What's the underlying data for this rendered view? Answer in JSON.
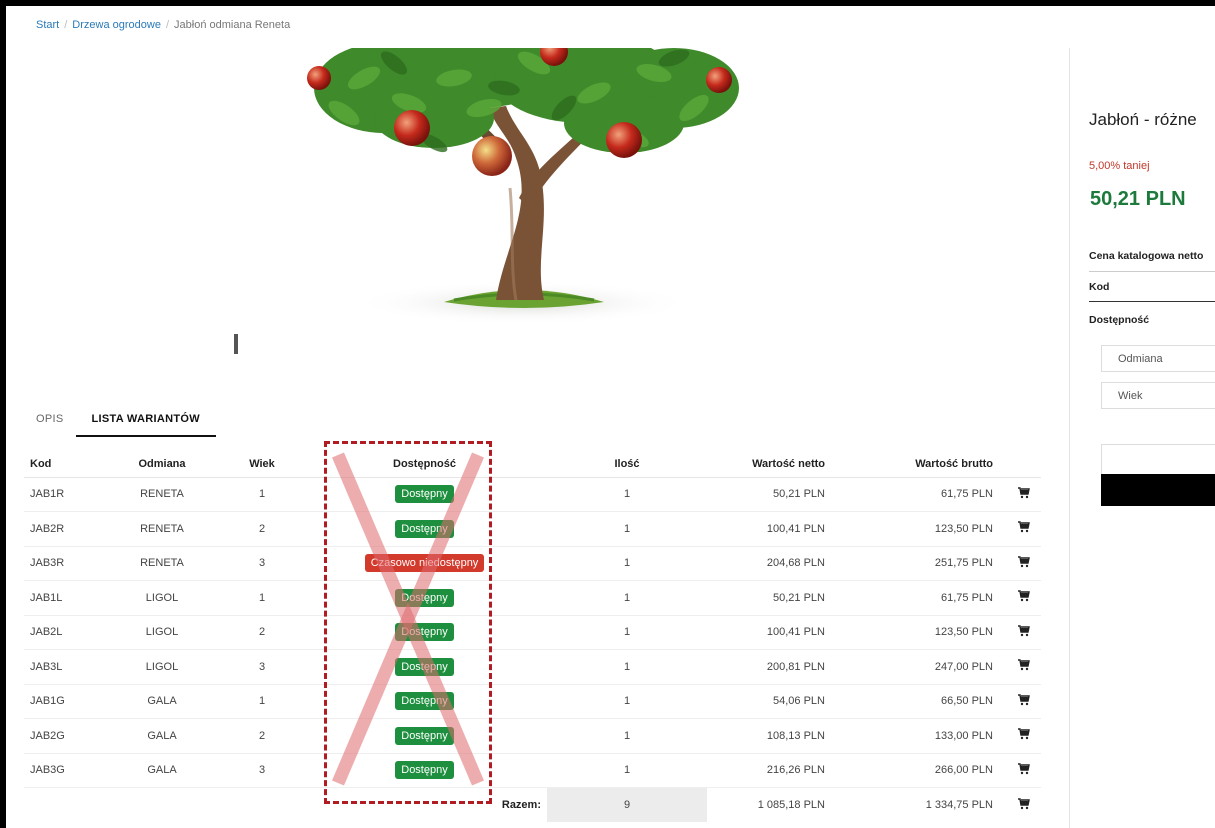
{
  "breadcrumb": {
    "items": [
      "Start",
      "Drzewa ogrodowe"
    ],
    "current": "Jabłoń odmiana Reneta"
  },
  "tabs": [
    {
      "label": "OPIS",
      "active": false
    },
    {
      "label": "LISTA WARIANTÓW",
      "active": true
    }
  ],
  "table": {
    "headers": {
      "kod": "Kod",
      "odmiana": "Odmiana",
      "wiek": "Wiek",
      "dostepnosc": "Dostępność",
      "ilosc": "Ilość",
      "netto": "Wartość netto",
      "brutto": "Wartość brutto"
    },
    "rows": [
      {
        "kod": "JAB1R",
        "odmiana": "RENETA",
        "wiek": "1",
        "status": "Dostępny",
        "available": true,
        "ilosc": "1",
        "netto": "50,21 PLN",
        "brutto": "61,75 PLN"
      },
      {
        "kod": "JAB2R",
        "odmiana": "RENETA",
        "wiek": "2",
        "status": "Dostępny",
        "available": true,
        "ilosc": "1",
        "netto": "100,41 PLN",
        "brutto": "123,50 PLN"
      },
      {
        "kod": "JAB3R",
        "odmiana": "RENETA",
        "wiek": "3",
        "status": "Czasowo niedostępny",
        "available": false,
        "ilosc": "1",
        "netto": "204,68 PLN",
        "brutto": "251,75 PLN"
      },
      {
        "kod": "JAB1L",
        "odmiana": "LIGOL",
        "wiek": "1",
        "status": "Dostępny",
        "available": true,
        "ilosc": "1",
        "netto": "50,21 PLN",
        "brutto": "61,75 PLN"
      },
      {
        "kod": "JAB2L",
        "odmiana": "LIGOL",
        "wiek": "2",
        "status": "Dostępny",
        "available": true,
        "ilosc": "1",
        "netto": "100,41 PLN",
        "brutto": "123,50 PLN"
      },
      {
        "kod": "JAB3L",
        "odmiana": "LIGOL",
        "wiek": "3",
        "status": "Dostępny",
        "available": true,
        "ilosc": "1",
        "netto": "200,81 PLN",
        "brutto": "247,00 PLN"
      },
      {
        "kod": "JAB1G",
        "odmiana": "GALA",
        "wiek": "1",
        "status": "Dostępny",
        "available": true,
        "ilosc": "1",
        "netto": "54,06 PLN",
        "brutto": "66,50 PLN"
      },
      {
        "kod": "JAB2G",
        "odmiana": "GALA",
        "wiek": "2",
        "status": "Dostępny",
        "available": true,
        "ilosc": "1",
        "netto": "108,13 PLN",
        "brutto": "133,00 PLN"
      },
      {
        "kod": "JAB3G",
        "odmiana": "GALA",
        "wiek": "3",
        "status": "Dostępny",
        "available": true,
        "ilosc": "1",
        "netto": "216,26 PLN",
        "brutto": "266,00 PLN"
      }
    ],
    "summary": {
      "label": "Razem:",
      "ilosc": "9",
      "netto": "1 085,18 PLN",
      "brutto": "1 334,75 PLN"
    }
  },
  "sidebar": {
    "title": "Jabłoń - różne",
    "discount": "5,00% taniej",
    "price": "50,21 PLN",
    "rows": [
      "Cena katalogowa netto",
      "Kod",
      "Dostępność"
    ],
    "select_odmiana": "Odmiana",
    "select_wiek": "Wiek"
  },
  "colors": {
    "link": "#2a7ab8",
    "price": "#1d7a3c",
    "discount": "#c0392b",
    "badge_available": "#1e8f3e",
    "badge_unavailable": "#d23a2c",
    "annotation": "#b01c22"
  }
}
